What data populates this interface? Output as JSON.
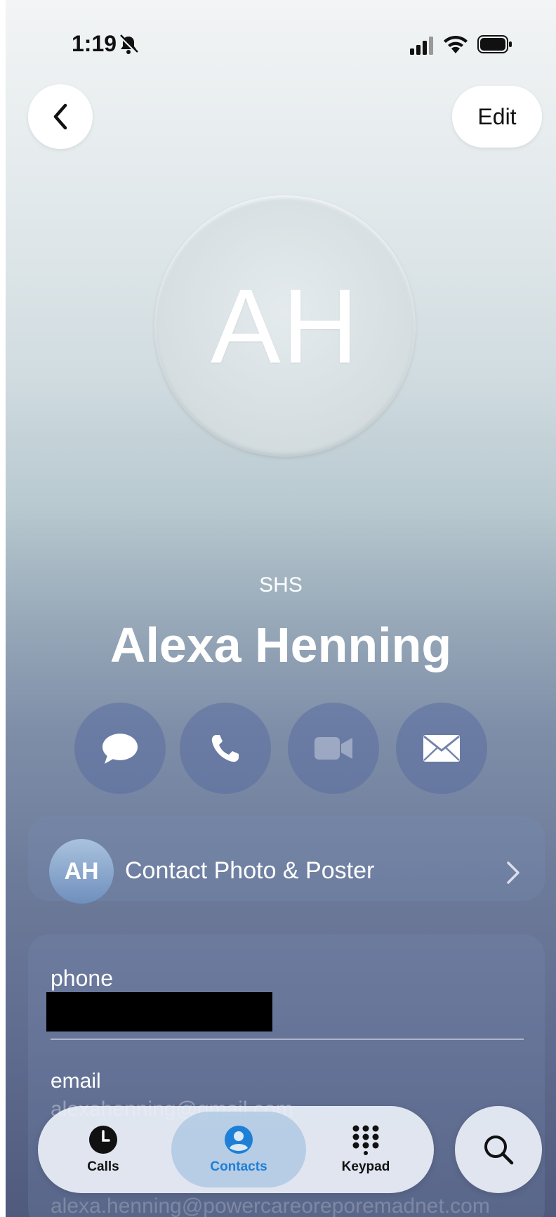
{
  "status_bar": {
    "time": "1:19"
  },
  "header": {
    "back_icon": "chevron-left-icon",
    "edit_label": "Edit"
  },
  "contact": {
    "initials": "AH",
    "organization": "SHS",
    "name": "Alexa Henning"
  },
  "actions": [
    {
      "name": "message",
      "icon": "message-bubble-icon"
    },
    {
      "name": "call",
      "icon": "phone-icon"
    },
    {
      "name": "video",
      "icon": "video-camera-icon"
    },
    {
      "name": "mail",
      "icon": "envelope-icon"
    }
  ],
  "poster_row": {
    "initials": "AH",
    "label": "Contact Photo & Poster"
  },
  "info": {
    "phone_label": "phone",
    "email_label": "email",
    "email_value_obscured": "alexahenning@gmail.com",
    "email_value_faded": "alexa.henning@powercareoreporemadnet.com"
  },
  "tab_bar": {
    "tabs": [
      {
        "label": "Calls",
        "icon": "clock-icon"
      },
      {
        "label": "Contacts",
        "icon": "person-circle-icon",
        "selected": true
      },
      {
        "label": "Keypad",
        "icon": "keypad-grid-icon"
      }
    ],
    "accent_color": "#1e7fd6"
  },
  "search": {
    "icon": "search-icon"
  }
}
